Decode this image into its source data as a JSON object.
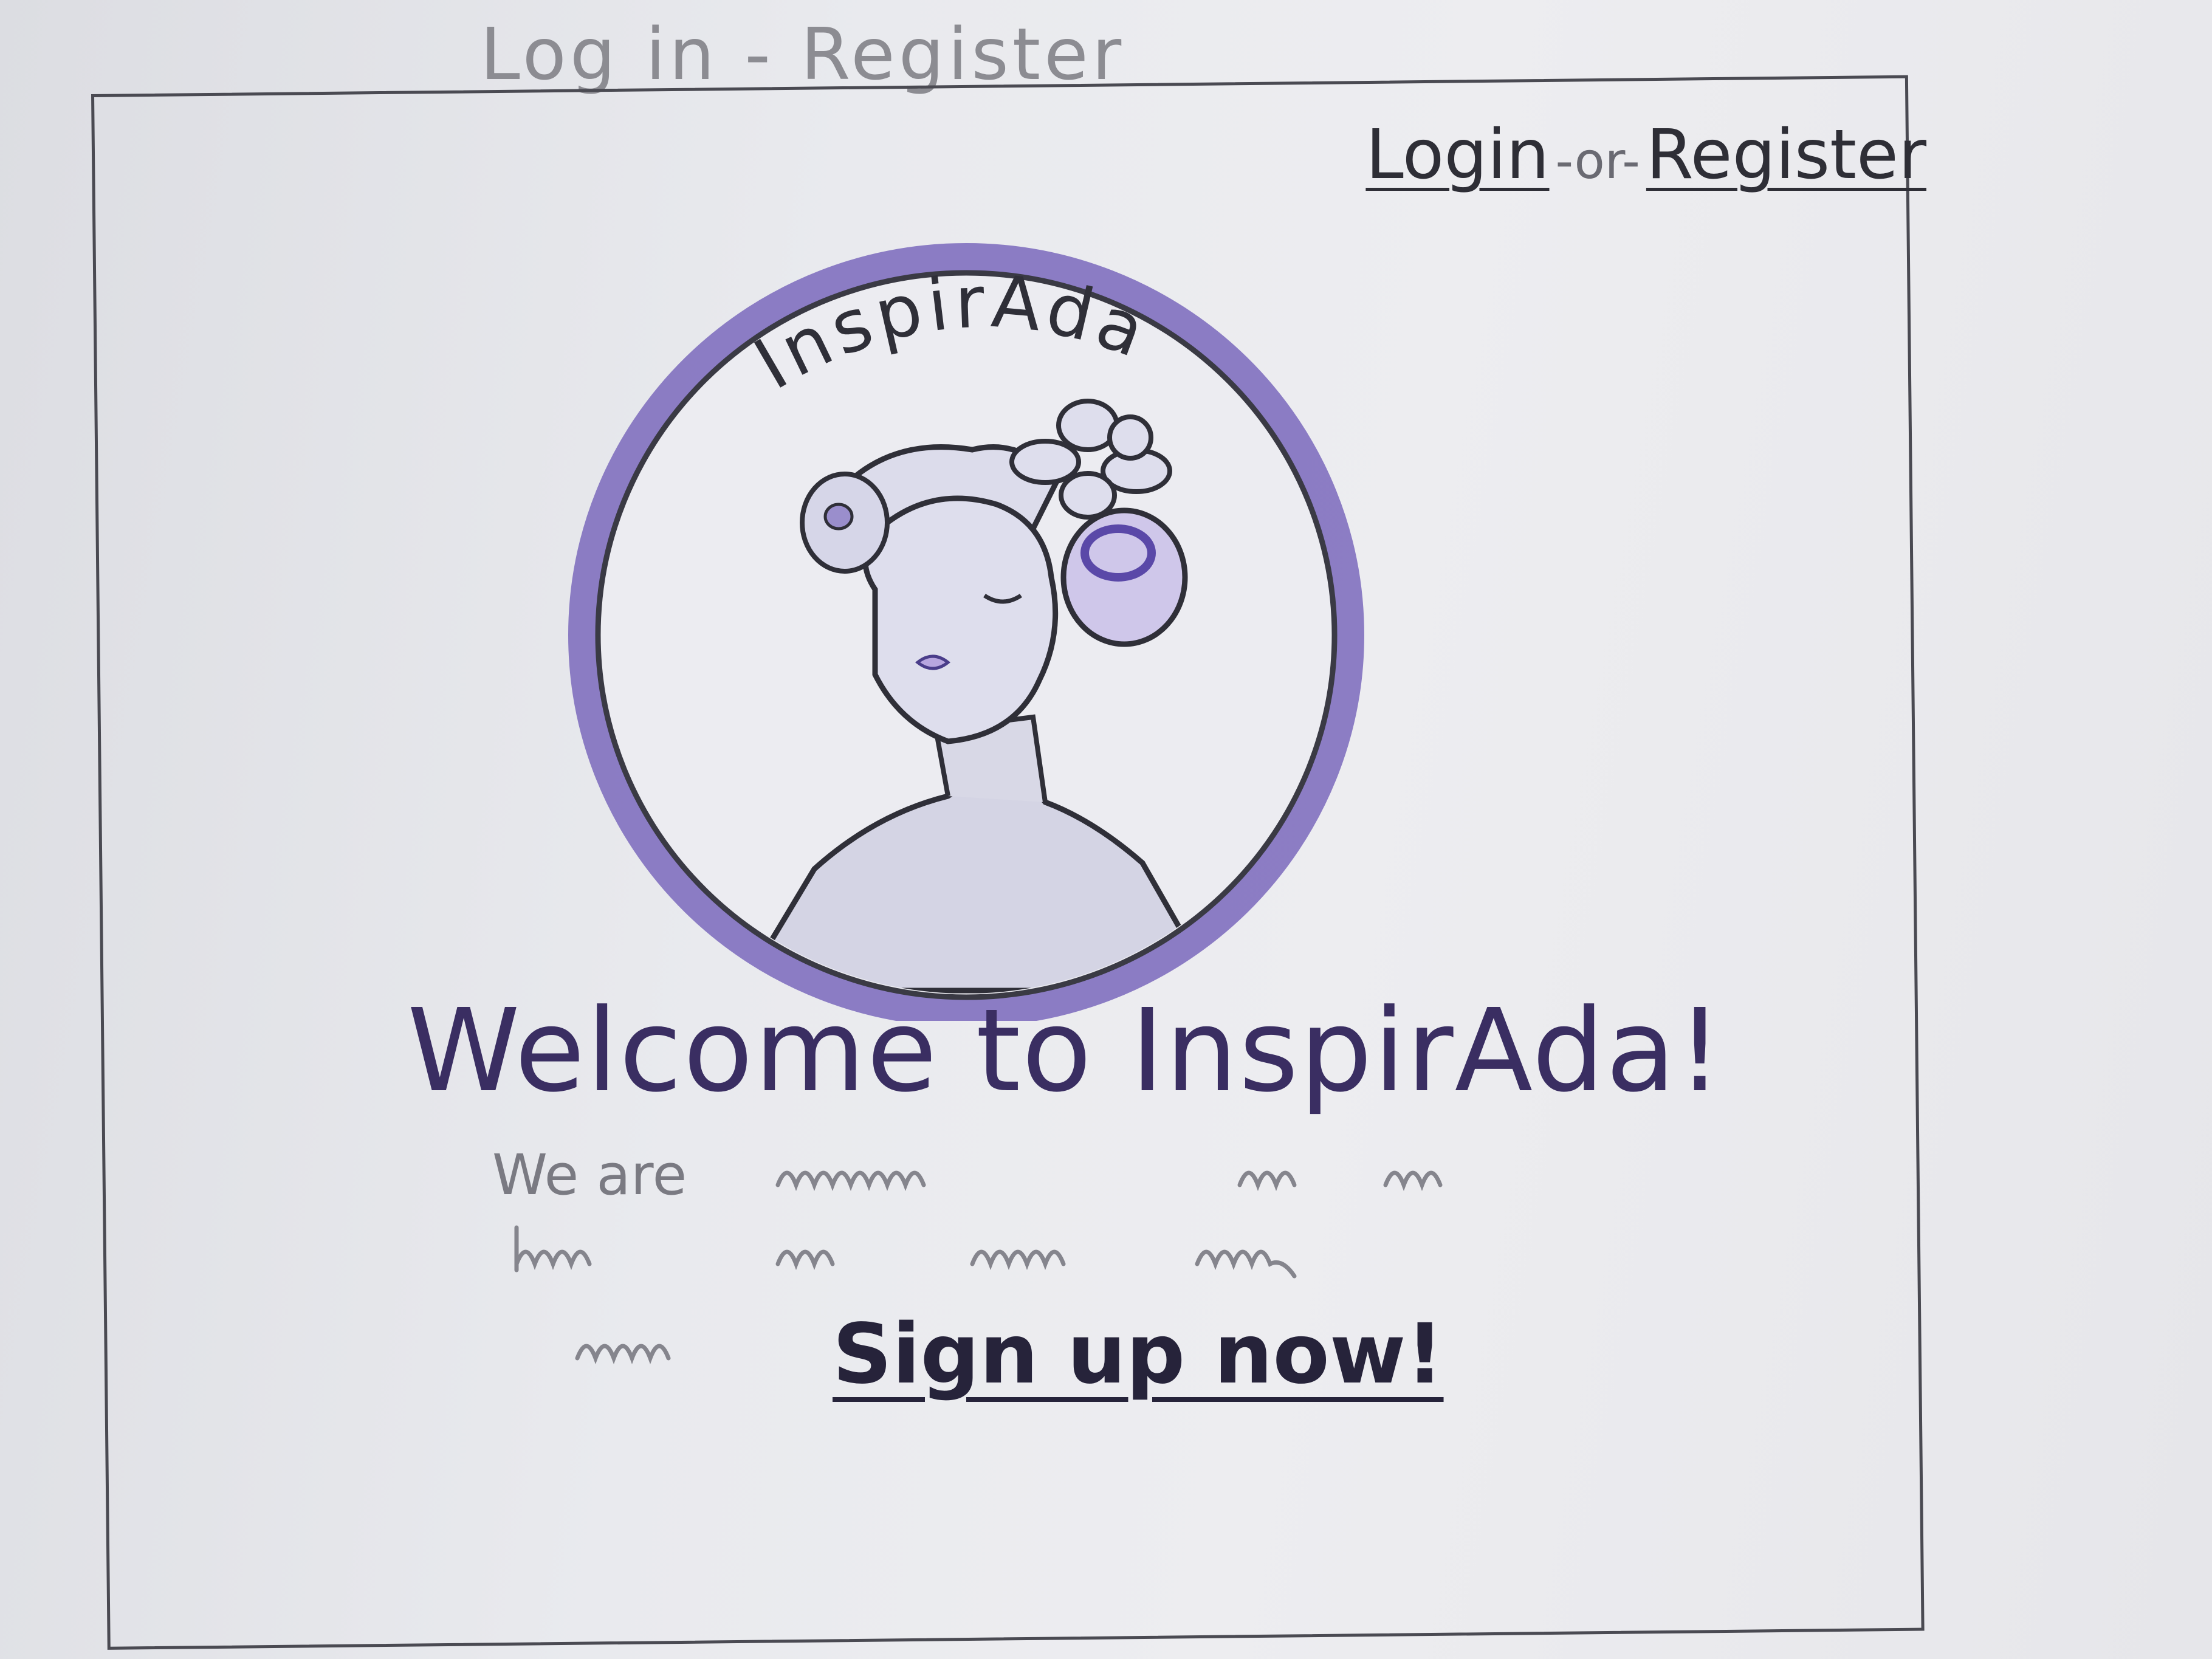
{
  "sheet": {
    "title": "Log in - Register"
  },
  "nav": {
    "login_label": "Login",
    "separator": "-or-",
    "register_label": "Register"
  },
  "logo": {
    "brand_text": "InspirAda",
    "ring_color": "#6a58b0",
    "fill_color": "#dcdcea"
  },
  "hero": {
    "welcome_text": "Welcome to InspirAda!",
    "blurb_start": "We are",
    "signup_label": "Sign up now!"
  },
  "colors": {
    "ink": "#2e2e36",
    "accent_purple": "#6a58b0",
    "pencil_gray": "#7a7a82"
  }
}
